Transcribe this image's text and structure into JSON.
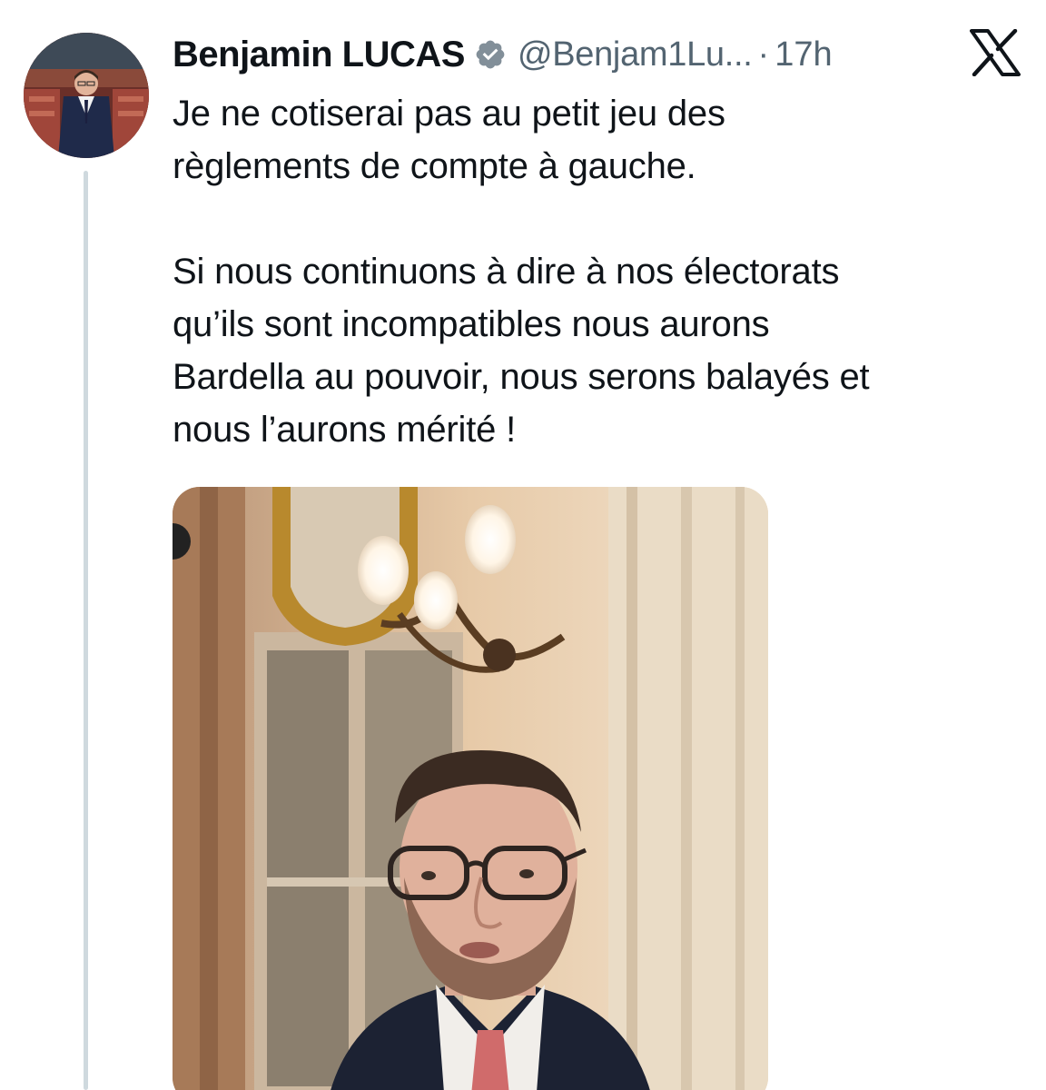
{
  "author": {
    "name": "Benjamin LUCAS",
    "handle": "@Benjam1Lu...",
    "separator": "·",
    "time": "17h"
  },
  "icons": {
    "verified": "verified-badge-icon",
    "platform": "x-logo-icon"
  },
  "colors": {
    "text": "#0f1419",
    "secondary": "#536471",
    "thread_line": "#cfd9de"
  },
  "tweet": {
    "paragraph_1": "Je ne cotiserai pas au petit jeu des\nrèglements de compte à gauche.",
    "paragraph_2": "Si nous continuons à dire à nos électorats\nqu’ils sont incompatibles nous aurons\nBardella au pouvoir, nous serons balayés et\nnous l’aurons mérité !"
  }
}
